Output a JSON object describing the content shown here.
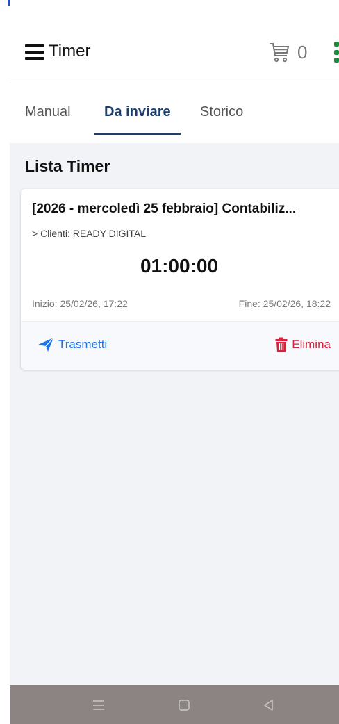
{
  "app": {
    "title": "Timer"
  },
  "cart": {
    "count": "0",
    "icon": "cart-icon"
  },
  "tabs": [
    {
      "label": "Manual",
      "active": false
    },
    {
      "label": "Da inviare",
      "active": true
    },
    {
      "label": "Storico",
      "active": false
    }
  ],
  "section": {
    "title": "Lista Timer"
  },
  "timer_card": {
    "title": "[2026 - mercoledì 25 febbraio] Contabiliz...",
    "client": "> Clienti: READY DIGITAL",
    "duration": "01:00:00",
    "start": "Inizio: 25/02/26, 17:22",
    "end": "Fine: 25/02/26, 18:22",
    "transmit_label": "Trasmetti",
    "delete_label": "Elimina"
  },
  "colors": {
    "active_tab": "#1c3f6e",
    "transmit": "#1a73e8",
    "delete": "#d6223a",
    "menu_dots": "#1b8a3a",
    "background": "#f1f3f6"
  },
  "icons": [
    "menu-icon",
    "cart-icon",
    "more-vert-icon",
    "send-icon",
    "trash-icon",
    "nav-menu-icon",
    "nav-home-icon",
    "nav-back-icon"
  ]
}
